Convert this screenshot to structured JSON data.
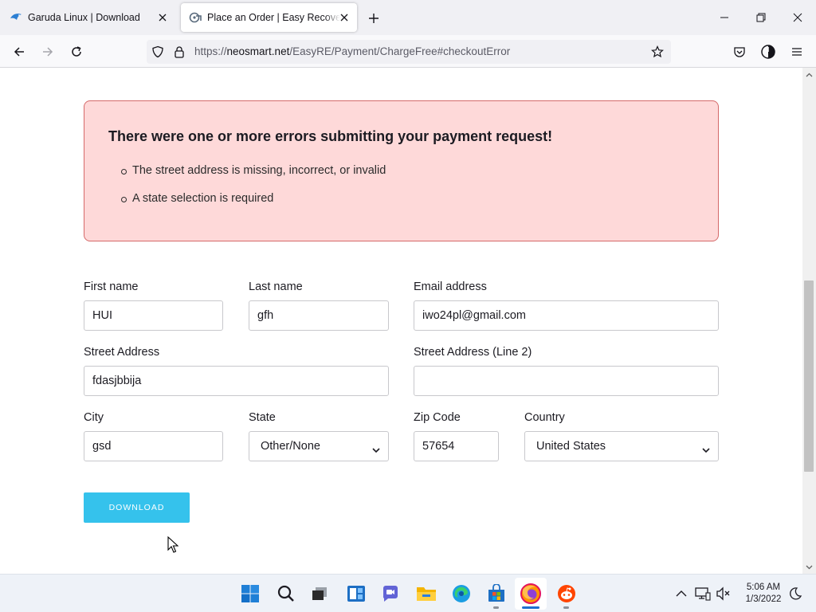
{
  "browser": {
    "tabs": [
      {
        "title": "Garuda Linux | Download",
        "icon": "garuda-bird-icon",
        "active": false
      },
      {
        "title": "Place an Order | Easy Recovery E",
        "icon": "neosmart-icon",
        "active": true
      }
    ],
    "url": {
      "prefix": "https://",
      "domain": "neosmart.net",
      "path": "/EasyRE/Payment/ChargeFree#checkoutError"
    },
    "accent": "#0060df"
  },
  "error": {
    "title": "There were one or more errors submitting your payment request!",
    "items": [
      "The street address is missing, incorrect, or invalid",
      "A state selection is required"
    ],
    "background": "#fed9d9",
    "border": "#d56a6a"
  },
  "form": {
    "first_name": {
      "label": "First name",
      "value": "HUI"
    },
    "last_name": {
      "label": "Last name",
      "value": "gfh"
    },
    "email": {
      "label": "Email address",
      "value": "iwo24pl@gmail.com"
    },
    "street": {
      "label": "Street Address",
      "value": "fdasjbbija"
    },
    "street2": {
      "label": "Street Address (Line 2)",
      "value": ""
    },
    "city": {
      "label": "City",
      "value": "gsd"
    },
    "state": {
      "label": "State",
      "value": "Other/None"
    },
    "zip": {
      "label": "Zip Code",
      "value": "57654"
    },
    "country": {
      "label": "Country",
      "value": "United States"
    },
    "submit_label": "DOWNLOAD",
    "submit_color": "#35c2ec"
  },
  "taskbar": {
    "apps": [
      "start-icon",
      "search-icon",
      "task-view-icon",
      "widgets-icon",
      "chat-icon",
      "file-explorer-icon",
      "edge-icon",
      "store-icon",
      "firefox-icon",
      "reddit-icon"
    ],
    "time": "5:06 AM",
    "date": "1/3/2022"
  }
}
